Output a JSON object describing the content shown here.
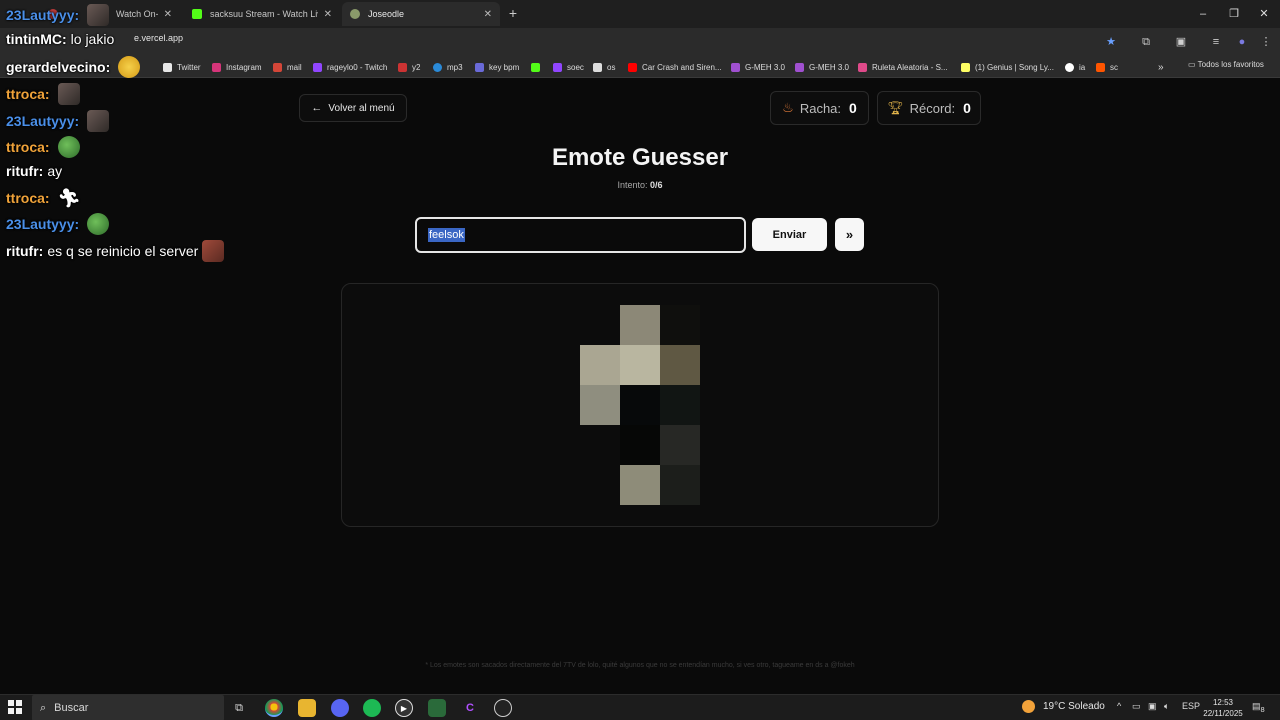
{
  "browser": {
    "tabs": [
      {
        "title": "Watch On-Dem",
        "color": "#b83a3a"
      },
      {
        "title": "sacksuu Stream - Watch Live on",
        "color": "#53fc18"
      },
      {
        "title": "Joseodle",
        "color": "#8a9a6a"
      }
    ],
    "address": "e.vercel.app",
    "window_controls": [
      "–",
      "❐",
      "✕"
    ],
    "bookmarks": [
      {
        "label": "Twitter",
        "color": "#e7e7e7"
      },
      {
        "label": "Instagram",
        "color": "#d6357a"
      },
      {
        "label": "mail",
        "color": "#d44638"
      },
      {
        "label": "rageylo0 - Twitch",
        "color": "#9146ff"
      },
      {
        "label": "y2",
        "color": "#cc3333"
      },
      {
        "label": "mp3",
        "color": "#2a8ad8"
      },
      {
        "label": "key bpm",
        "color": "#6a6ad8"
      },
      {
        "label": "",
        "color": "#53fc18"
      },
      {
        "label": "soec",
        "color": "#9146ff"
      },
      {
        "label": "os",
        "color": "#dddddd"
      },
      {
        "label": "Car Crash and Siren...",
        "color": "#ff0000"
      },
      {
        "label": "G-MEH 3.0",
        "color": "#a050d0"
      },
      {
        "label": "G-MEH 3.0",
        "color": "#a050d0"
      },
      {
        "label": "Ruleta Aleatoria - S...",
        "color": "#e04a8a"
      },
      {
        "label": "(1) Genius | Song Ly...",
        "color": "#ffff64"
      },
      {
        "label": "ia",
        "color": "#ffffff"
      },
      {
        "label": "sc",
        "color": "#ff5500"
      }
    ],
    "bookmarks_more": "»",
    "all_favorites": "Todos los favoritos"
  },
  "chat": [
    {
      "user": "23Lautyyy",
      "color": "#4a8fe8",
      "text": "",
      "emote": "face"
    },
    {
      "user": "tintinMC",
      "color": "#ffffff",
      "text": "lo jakio",
      "emote": "none"
    },
    {
      "user": "gerardelvecino",
      "color": "#ffffff",
      "text": "",
      "emote": "sweat"
    },
    {
      "user": "ttroca",
      "color": "#f0a33a",
      "text": "",
      "emote": "face"
    },
    {
      "user": "23Lautyyy",
      "color": "#4a8fe8",
      "text": "",
      "emote": "face"
    },
    {
      "user": "ttroca",
      "color": "#f0a33a",
      "text": "",
      "emote": "frog"
    },
    {
      "user": "ritufr",
      "color": "#ffffff",
      "text": "ay",
      "emote": "none"
    },
    {
      "user": "ttroca",
      "color": "#f0a33a",
      "text": "",
      "emote": "run"
    },
    {
      "user": "23Lautyyy",
      "color": "#4a8fe8",
      "text": "",
      "emote": "frog"
    },
    {
      "user": "ritufr",
      "color": "#ffffff",
      "text": "es q se reinicio el server",
      "emote": "real"
    }
  ],
  "game": {
    "back_label": "Volver al menú",
    "streak_label": "Racha:",
    "streak_value": "0",
    "record_label": "Récord:",
    "record_value": "0",
    "title": "Emote Guesser",
    "attempt_label": "Intento:",
    "attempt_value": "0/6",
    "guess_value": "feelsok",
    "send_label": "Enviar",
    "skip_label": "»",
    "emote_pixels": [
      [
        "#0c0c0c",
        "#8c8877",
        "#0f0f0d"
      ],
      [
        "#aaa692",
        "#b9b6a0",
        "#5f5843"
      ],
      [
        "#8f8e7f",
        "#07090a",
        "#111513"
      ],
      [
        "#0c0c0c",
        "#060706",
        "#272825"
      ],
      [
        "#0c0c0c",
        "#8e8c79",
        "#1c1e1b"
      ]
    ],
    "footer": "* Los emotes son sacados directamente del 7TV de lolo, quité algunos que no se entendían mucho, si ves otro, tagueame en ds a @fokeh"
  },
  "taskbar": {
    "search_label": "Buscar",
    "weather": "19°C  Soleado",
    "lang": "ESP",
    "time": "12:53",
    "date": "22/11/2025",
    "notifications": "8"
  }
}
